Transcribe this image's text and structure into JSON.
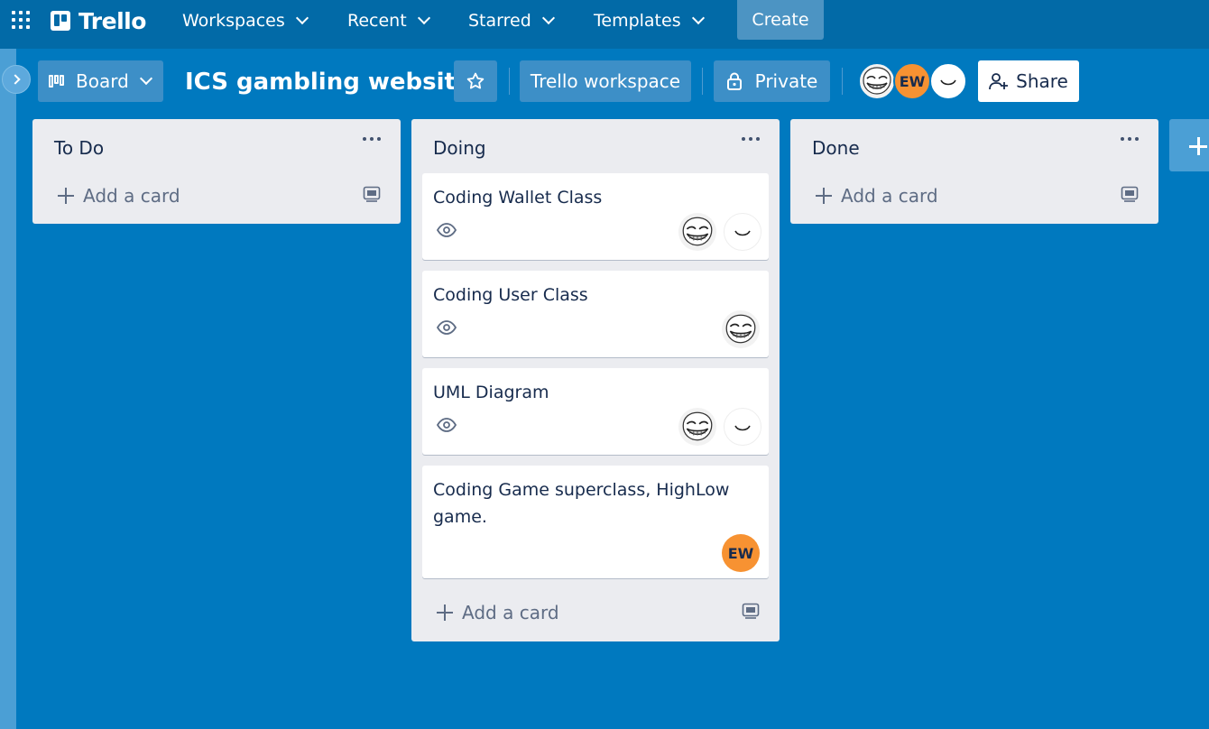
{
  "topnav": {
    "logo": "Trello",
    "items": [
      {
        "label": "Workspaces"
      },
      {
        "label": "Recent"
      },
      {
        "label": "Starred"
      },
      {
        "label": "Templates"
      }
    ],
    "create_label": "Create"
  },
  "board_header": {
    "view_label": "Board",
    "title": "ICS gambling website",
    "workspace_label": "Trello workspace",
    "visibility_label": "Private",
    "members": [
      {
        "type": "image",
        "name": "troll-face"
      },
      {
        "type": "initials",
        "initials": "EW",
        "color": "#f79232"
      },
      {
        "type": "image",
        "name": "smile-face"
      }
    ],
    "share_label": "Share"
  },
  "lists": [
    {
      "title": "To Do",
      "add_card_label": "Add a card",
      "cards": []
    },
    {
      "title": "Doing",
      "add_card_label": "Add a card",
      "cards": [
        {
          "title": "Coding Wallet Class",
          "watching": true,
          "members": [
            "troll-face",
            "smile-face"
          ]
        },
        {
          "title": "Coding User Class",
          "watching": true,
          "members": [
            "troll-face"
          ]
        },
        {
          "title": "UML Diagram",
          "watching": true,
          "members": [
            "troll-face",
            "smile-face"
          ]
        },
        {
          "title": "Coding Game superclass, HighLow game.",
          "watching": false,
          "members": [
            "EW"
          ]
        }
      ]
    },
    {
      "title": "Done",
      "add_card_label": "Add a card",
      "cards": []
    }
  ],
  "colors": {
    "board_background": "#0079bf",
    "topnav": "#026aa7",
    "list_background": "#ebecf0",
    "avatar_ew": "#f79232"
  }
}
